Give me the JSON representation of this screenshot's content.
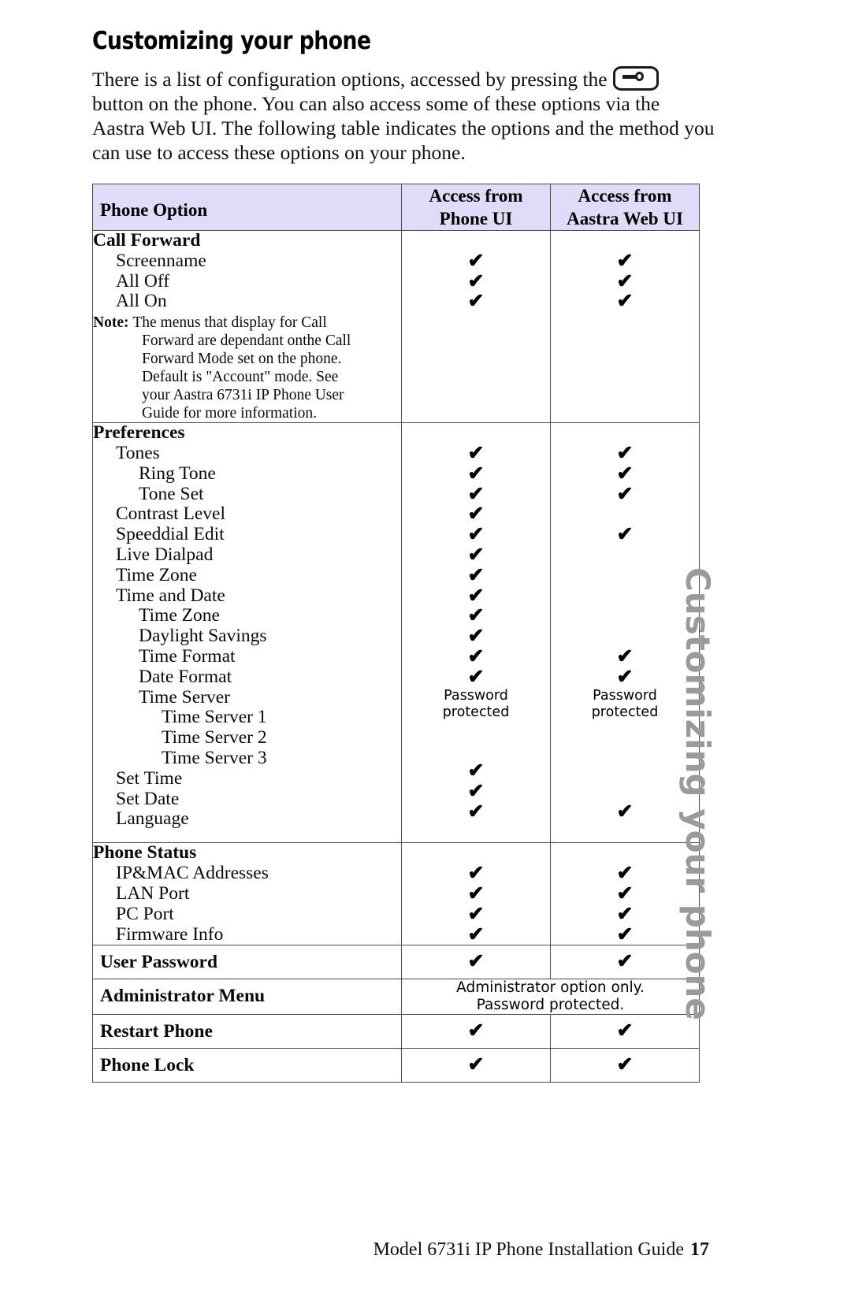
{
  "heading": "Customizing your phone",
  "intro": {
    "part1": "There is a list of configuration options, accessed by pressing the ",
    "icon": "phone-options-button-icon",
    "part2": " button on the phone. You can also access some of these options via the Aastra Web UI. The following table indicates the options and the method you can use to access these options on your phone."
  },
  "table": {
    "headers": {
      "option": "Phone Option",
      "phone_ui": "Access from\nPhone UI",
      "phone_ui_line1": "Access from",
      "phone_ui_line2": "Phone UI",
      "web_ui_line1": "Access from",
      "web_ui_line2": "Aastra Web UI"
    },
    "check_glyph": "✔",
    "groups": [
      {
        "id": "call-forward",
        "rows": [
          {
            "label": "Call Forward",
            "level": 1,
            "bold": true,
            "phone": "",
            "web": ""
          },
          {
            "label": "Screenname",
            "level": 2,
            "bold": false,
            "phone": "✔",
            "web": "✔"
          },
          {
            "label": "All Off",
            "level": 2,
            "bold": false,
            "phone": "✔",
            "web": "✔"
          },
          {
            "label": "All On",
            "level": 2,
            "bold": false,
            "phone": "✔",
            "web": "✔"
          }
        ],
        "note": {
          "label": "Note:",
          "lines": [
            "The menus that display for Call",
            "Forward are dependant onthe Call",
            "Forward Mode set on the phone.",
            "Default is \"Account\" mode. See",
            "your Aastra 6731i IP Phone User",
            "Guide for more information."
          ]
        }
      },
      {
        "id": "preferences",
        "rows": [
          {
            "label": "Preferences",
            "level": 1,
            "bold": true,
            "phone": "",
            "web": ""
          },
          {
            "label": "Tones",
            "level": 2,
            "bold": false,
            "phone": "✔",
            "web": "✔"
          },
          {
            "label": "Ring Tone",
            "level": 3,
            "bold": false,
            "phone": "✔",
            "web": "✔"
          },
          {
            "label": "Tone Set",
            "level": 3,
            "bold": false,
            "phone": "✔",
            "web": "✔"
          },
          {
            "label": "Contrast Level",
            "level": 2,
            "bold": false,
            "phone": "✔",
            "web": ""
          },
          {
            "label": "Speeddial Edit",
            "level": 2,
            "bold": false,
            "phone": "✔",
            "web": "✔"
          },
          {
            "label": "Live Dialpad",
            "level": 2,
            "bold": false,
            "phone": "✔",
            "web": ""
          },
          {
            "label": "Time Zone",
            "level": 2,
            "bold": false,
            "phone": "✔",
            "web": ""
          },
          {
            "label": "Time and Date",
            "level": 2,
            "bold": false,
            "phone": "✔",
            "web": ""
          },
          {
            "label": "Time Zone",
            "level": 3,
            "bold": false,
            "phone": "✔",
            "web": ""
          },
          {
            "label": "Daylight Savings",
            "level": 3,
            "bold": false,
            "phone": "✔",
            "web": ""
          },
          {
            "label": "Time Format",
            "level": 3,
            "bold": false,
            "phone": "✔",
            "web": "✔"
          },
          {
            "label": "Date Format",
            "level": 3,
            "bold": false,
            "phone": "✔",
            "web": "✔"
          },
          {
            "label": "Time Server",
            "level": 3,
            "bold": false,
            "phone": "Password protected",
            "web": "Password protected",
            "textcell": true
          },
          {
            "label": "Time Server 1",
            "level": 4,
            "bold": false,
            "phone": "",
            "web": ""
          },
          {
            "label": "Time Server 2",
            "level": 4,
            "bold": false,
            "phone": "",
            "web": ""
          },
          {
            "label": "Time Server 3",
            "level": 4,
            "bold": false,
            "phone": "✔",
            "web": ""
          },
          {
            "label": "Set Time",
            "level": 2,
            "bold": false,
            "phone": "✔",
            "web": ""
          },
          {
            "label": "Set Date",
            "level": 2,
            "bold": false,
            "phone": "✔",
            "web": "✔"
          },
          {
            "label": "Language",
            "level": 2,
            "bold": false,
            "phone": "",
            "web": ""
          }
        ]
      },
      {
        "id": "phone-status",
        "rows": [
          {
            "label": "Phone Status",
            "level": 1,
            "bold": true,
            "phone": "",
            "web": ""
          },
          {
            "label": "IP&MAC Addresses",
            "level": 2,
            "bold": false,
            "phone": "✔",
            "web": "✔"
          },
          {
            "label": "LAN Port",
            "level": 2,
            "bold": false,
            "phone": "✔",
            "web": "✔"
          },
          {
            "label": "PC Port",
            "level": 2,
            "bold": false,
            "phone": "✔",
            "web": "✔"
          },
          {
            "label": "Firmware Info",
            "level": 2,
            "bold": false,
            "phone": "✔",
            "web": "✔"
          }
        ]
      }
    ],
    "simple_rows": [
      {
        "id": "user-password",
        "label": "User Password",
        "phone": "✔",
        "web": "✔"
      },
      {
        "id": "restart-phone",
        "label": "Restart Phone",
        "phone": "✔",
        "web": "✔"
      },
      {
        "id": "phone-lock",
        "label": "Phone Lock",
        "phone": "✔",
        "web": "✔"
      }
    ],
    "admin_row": {
      "id": "administrator-menu",
      "label": "Administrator Menu",
      "merged_line1": "Administrator option only.",
      "merged_line2": "Password protected."
    },
    "password_protected_line1": "Password",
    "password_protected_line2": "protected"
  },
  "sidebar_running_head": "Customizing your phone",
  "footer": {
    "title": "Model 6731i IP Phone Installation Guide",
    "page_number": "17"
  }
}
